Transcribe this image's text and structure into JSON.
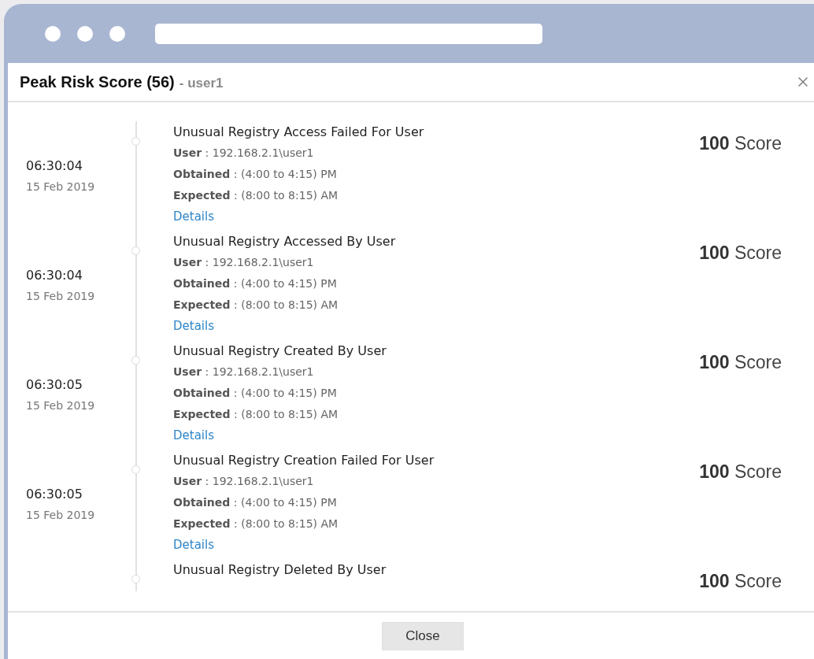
{
  "dialog": {
    "title": "Peak Risk Score (56)",
    "subtitle": "- user1"
  },
  "entries": [
    {
      "time": "06:30:04",
      "date": "15 Feb 2019",
      "title": "Unusual Registry Access Failed For User",
      "fields": [
        "**User** : 192.168.2.1\\user1",
        "**Obtained** : (4:00 to 4:15) PM",
        "**Expected** : (8:00 to 8:15) AM"
      ],
      "link": "Details",
      "score": "**100** Score"
    },
    {
      "time": "06:30:04",
      "date": "15 Feb 2019",
      "title": "Unusual Registry Accessed By User",
      "fields": [
        "**User** : 192.168.2.1\\user1",
        "**Obtained** : (4:00 to 4:15) PM",
        "**Expected** : (8:00 to 8:15) AM"
      ],
      "link": "Details",
      "score": "**100** Score"
    },
    {
      "time": "06:30:05",
      "date": "15 Feb 2019",
      "title": "Unusual Registry Created By User",
      "fields": [
        "**User** : 192.168.2.1\\user1",
        "**Obtained** : (4:00 to 4:15) PM",
        "**Expected** : (8:00 to 8:15) AM"
      ],
      "link": "Details",
      "score": "**100** Score"
    },
    {
      "time": "06:30:05",
      "date": "15 Feb 2019",
      "title": "Unusual Registry Creation Failed For User",
      "fields": [
        "**User** : 192.168.2.1\\user1",
        "**Obtained** : (4:00 to 4:15) PM",
        "**Expected** : (8:00 to 8:15) AM"
      ],
      "link": "Details",
      "score": "**100** Score"
    },
    {
      "title": "Unusual Registry Deleted By User",
      "score": "**100** Score"
    }
  ],
  "footer": {
    "button": "Close"
  }
}
